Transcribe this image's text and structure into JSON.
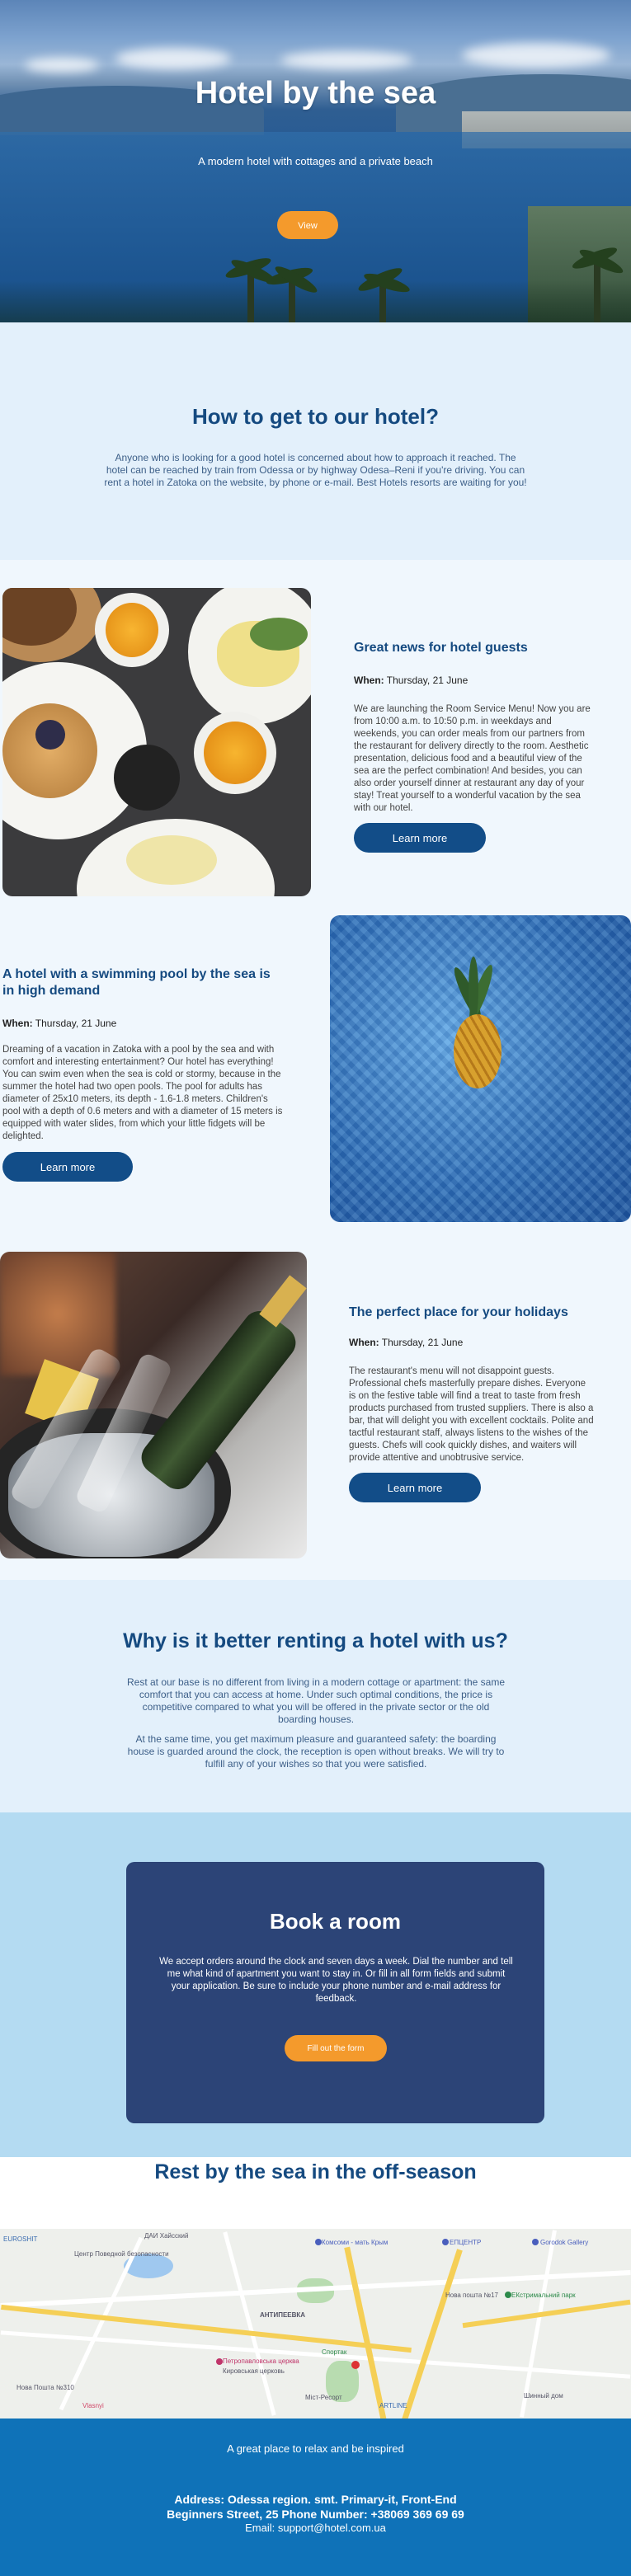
{
  "hero": {
    "title": "Hotel by the sea",
    "subtitle": "A modern hotel with cottages and a private beach",
    "button_label": "View"
  },
  "how_to_get": {
    "title": "How to get to our hotel?",
    "text": "Anyone who is looking for a good hotel is concerned about how to approach it reached. The hotel can be reached by train from Odessa or by highway Odesa–Reni if you're driving. You can rent a hotel in Zatoka on the website, by phone or e-mail. Best Hotels resorts are waiting for you!"
  },
  "features": [
    {
      "title": "Great news for hotel guests",
      "when_label": "When:",
      "when_value": "Thursday, 21 June",
      "text": "We are launching the Room Service Menu! Now you are from 10:00 a.m. to 10:50 p.m. in weekdays and weekends, you can order meals from our partners from the restaurant for delivery directly to the room. Aesthetic presentation, delicious food and a beautiful view of the sea are the perfect combination! And besides, you can also order yourself dinner at restaurant any day of your stay! Treat yourself to a wonderful vacation by the sea with our hotel.",
      "button_label": "Learn more",
      "image": "breakfast-photo"
    },
    {
      "title": "A hotel with a swimming pool by the sea is in high demand",
      "when_label": "When:",
      "when_value": "Thursday, 21 June",
      "text": "Dreaming of a vacation in Zatoka with a pool by the sea and with comfort and interesting entertainment? Our hotel has everything! You can swim even when the sea is cold or stormy, because in the summer the hotel had two open pools. The pool for adults has diameter of 25x10 meters, its depth - 1.6-1.8 meters. Children's pool with a depth of 0.6 meters and with a diameter of 15 meters is equipped with water slides, from which your little fidgets will be delighted.",
      "button_label": "Learn more",
      "image": "pineapple-pool-photo"
    },
    {
      "title": "The perfect place for your holidays",
      "when_label": "When:",
      "when_value": "Thursday, 21 June",
      "text": "The restaurant's menu will not disappoint guests. Professional chefs masterfully prepare dishes. Everyone is on the festive table will find a treat to taste from fresh products purchased from trusted suppliers. There is also a bar, that will delight you with excellent cocktails. Polite and tactful restaurant staff, always listens to the wishes of the guests. Chefs will cook quickly dishes, and waiters will provide attentive and unobtrusive service.",
      "button_label": "Learn more",
      "image": "champagne-photo"
    }
  ],
  "why": {
    "title": "Why is it better renting a hotel with us?",
    "p1": "Rest at our base is no different from living in a modern cottage or apartment: the same comfort that you can access at home. Under such optimal conditions, the price is competitive compared to what you will be offered in the private sector or the old boarding houses.",
    "p2": "At the same time, you get maximum pleasure and guaranteed safety: the boarding house is guarded around the clock, the reception is open without breaks. We will try to fulfill any of your wishes so that you were satisfied."
  },
  "booking": {
    "title": "Book a room",
    "text": "We accept orders around the clock and seven days a week. Dial the number and tell me what kind of apartment you want to stay in. Or fill in all form fields and submit your application. Be sure to include your phone number and e-mail address for feedback.",
    "button_label": "Fill out the form"
  },
  "rest": {
    "title": "Rest by the sea in the off-season"
  },
  "map": {
    "labels": [
      "EUROSHIT",
      "Центр Поведной безопасности",
      "ДАИ Хайсский",
      "Комсоми - мать Крым",
      "ЕПЦЕНТР",
      "Gorodok Gallery",
      "АНТИПЕЕВКА",
      "Нова пошта №17",
      "ЕКстримальний парк",
      "Кировськая церковь",
      "Петропавловська церква",
      "Спортак",
      "Шинный дом",
      "ARTLINE",
      "Міст-Ресорт",
      "Vlasnyi",
      "Нова Пошта №310"
    ],
    "colors": {
      "road_major": "#f5cf56",
      "water": "#9fc8ef",
      "park": "#b8dcb0"
    }
  },
  "footer": {
    "tagline": "A great place to relax and be inspired",
    "address": "Address: Odessa region. smt. Primary-it, Front-End Beginners Street, 25 Phone Number: +38069 369 69 69",
    "email": "Email: support@hotel.com.ua"
  },
  "colors": {
    "accent_orange": "#f49a2c",
    "heading_blue": "#154a80",
    "button_blue": "#124d88",
    "card_navy": "#2c4477",
    "footer_blue": "#0f72b8"
  }
}
